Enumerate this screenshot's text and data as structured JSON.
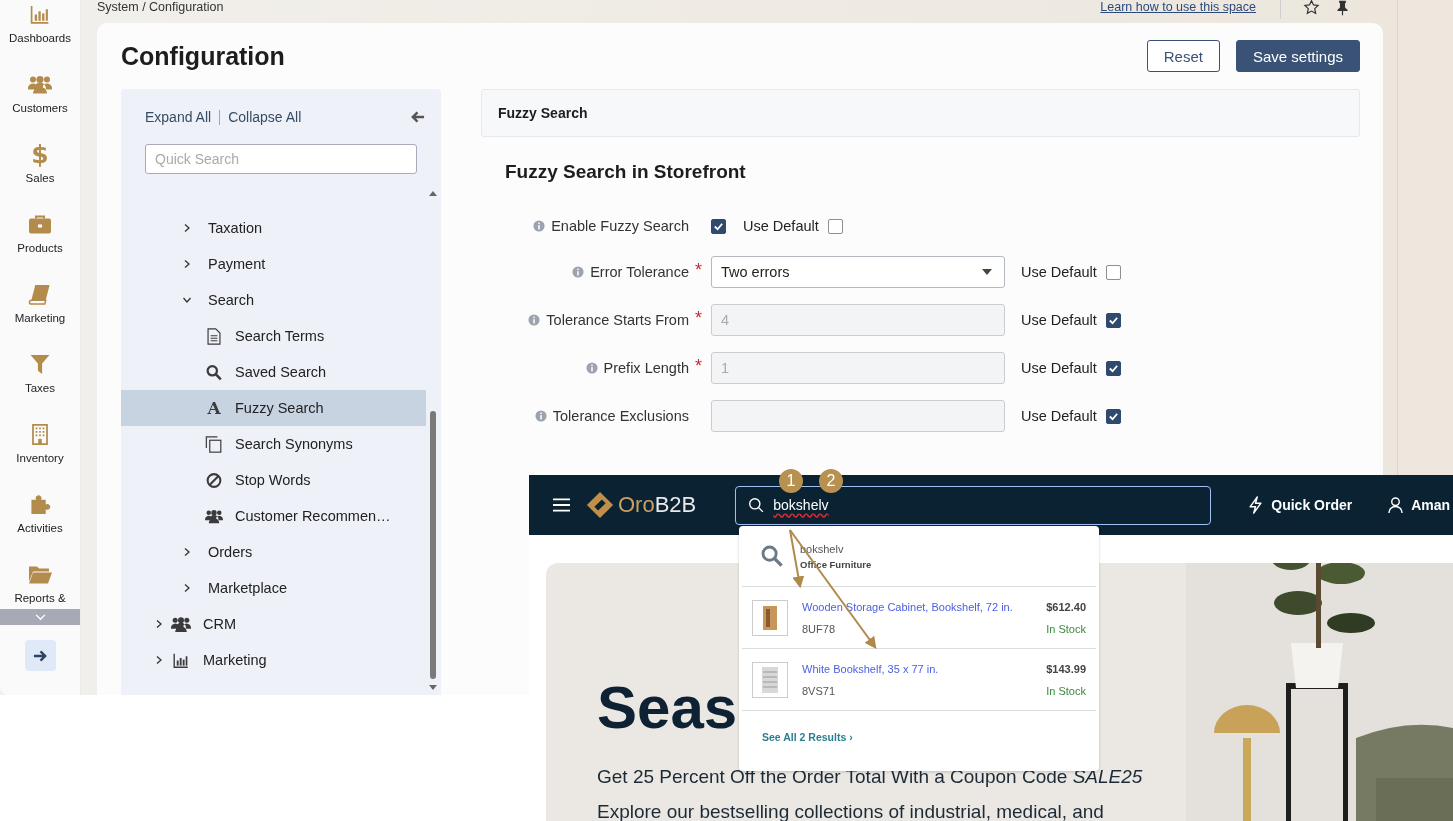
{
  "nav": [
    {
      "label": "Dashboards"
    },
    {
      "label": "Customers"
    },
    {
      "label": "Sales",
      "glyph": "$"
    },
    {
      "label": "Products"
    },
    {
      "label": "Marketing"
    },
    {
      "label": "Taxes"
    },
    {
      "label": "Inventory"
    },
    {
      "label": "Activities"
    },
    {
      "label": "Reports &"
    }
  ],
  "breadcrumb": "System / Configuration",
  "help_link": "Learn how to use this space",
  "page_title": "Configuration",
  "buttons": [
    {
      "label": "Reset",
      "kind": "secondary"
    },
    {
      "label": "Save settings",
      "kind": "primary"
    }
  ],
  "tree_panel": {
    "expand_all": "Expand All",
    "collapse_all": "Collapse All",
    "search_placeholder": "Quick Search"
  },
  "tree": [
    {
      "children": [
        {
          "label": "Taxation",
          "expanded": false,
          "selected": false
        },
        {
          "label": "Payment",
          "expanded": false,
          "selected": false
        },
        {
          "label": "Search",
          "expanded": true,
          "selected": false,
          "children": [
            {
              "label": "Search Terms",
              "selected": false
            },
            {
              "label": "Saved Search",
              "selected": false
            },
            {
              "label": "Fuzzy Search",
              "selected": true,
              "glyph": "A"
            },
            {
              "label": "Search Synonyms",
              "selected": false
            },
            {
              "label": "Stop Words",
              "selected": false
            },
            {
              "label": "Customer Recommen…",
              "selected": false
            }
          ]
        },
        {
          "label": "Orders",
          "expanded": false,
          "selected": false
        },
        {
          "label": "Marketplace",
          "expanded": false,
          "selected": false
        }
      ]
    },
    {
      "label": "CRM",
      "expanded": false,
      "selected": false
    },
    {
      "label": "Marketing",
      "expanded": false,
      "selected": false
    }
  ],
  "required_mark": "*",
  "section_header": "Fuzzy Search",
  "section_title": "Fuzzy Search in Storefront",
  "fields": [
    {
      "kind": "checkbox",
      "label": "Enable Fuzzy Search",
      "required": false,
      "checked": true,
      "use_default_label": "Use Default",
      "use_default": false
    },
    {
      "kind": "select",
      "label": "Error Tolerance",
      "required": true,
      "value": "Two errors",
      "disabled": false,
      "use_default_label": "Use Default",
      "use_default": false
    },
    {
      "kind": "input",
      "label": "Tolerance Starts From",
      "required": true,
      "value": "4",
      "disabled": true,
      "use_default_label": "Use Default",
      "use_default": true
    },
    {
      "kind": "input",
      "label": "Prefix Length",
      "required": true,
      "value": "1",
      "disabled": true,
      "use_default_label": "Use Default",
      "use_default": true
    },
    {
      "kind": "input",
      "label": "Tolerance Exclusions",
      "required": false,
      "disabled": true,
      "use_default_label": "Use Default",
      "use_default": true
    }
  ],
  "storefront": {
    "brand": {
      "first": "Oro",
      "second": "B2B"
    },
    "search_value": "bokshelv",
    "quick_order": "Quick Order",
    "user": "Aman",
    "annotations": [
      {
        "label": "1"
      },
      {
        "label": "2"
      }
    ],
    "suggestion": {
      "query": "bokshelv",
      "category": "Office Furniture"
    },
    "products": [
      {
        "name": "Wooden Storage Cabinet, Bookshelf, 72 in.",
        "sku": "8UF78",
        "price": "$612.40",
        "stock": "In Stock"
      },
      {
        "name": "White Bookshelf, 35 x 77 in.",
        "sku": "8VS71",
        "price": "$143.99",
        "stock": "In Stock"
      }
    ],
    "see_all": "See All 2 Results ›",
    "hero_title": "Seas",
    "hero_lines": [
      "Get 25 Percent Off the Order Total With a Coupon Code *SALE25*",
      "Explore our bestselling collections of industrial, medical, and"
    ]
  }
}
